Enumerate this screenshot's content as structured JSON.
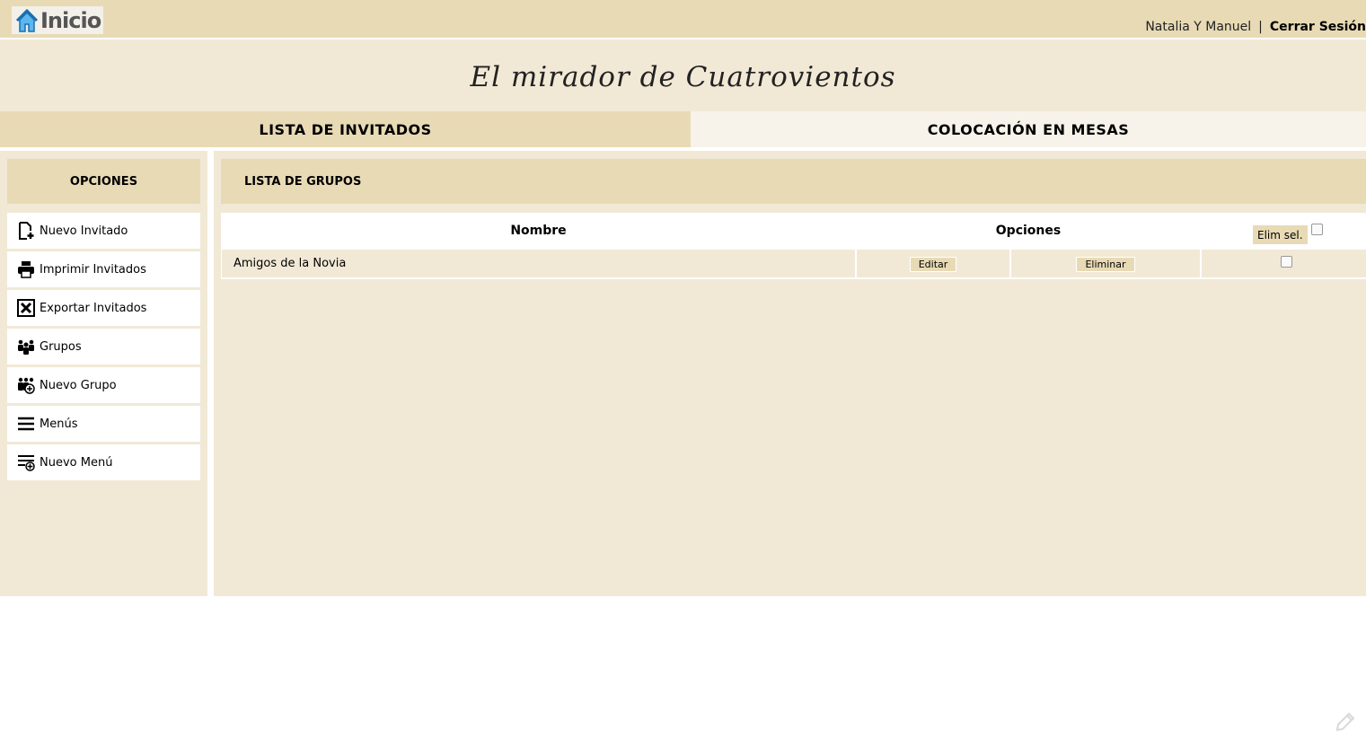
{
  "header": {
    "home_label": "Inicio",
    "user_name": "Natalia Y Manuel",
    "separator": "|",
    "logout_label": "Cerrar Sesión"
  },
  "banner": {
    "title": "El mirador de Cuatrovientos"
  },
  "tabs": [
    {
      "label": "LISTA DE INVITADOS",
      "active": true
    },
    {
      "label": "COLOCACIÓN EN MESAS",
      "active": false
    }
  ],
  "sidebar": {
    "title": "OPCIONES",
    "items": [
      {
        "label": "Nuevo Invitado",
        "icon": "new-file-icon"
      },
      {
        "label": "Imprimir Invitados",
        "icon": "printer-icon"
      },
      {
        "label": "Exportar Invitados",
        "icon": "excel-export-icon"
      },
      {
        "label": "Grupos",
        "icon": "group-icon"
      },
      {
        "label": "Nuevo Grupo",
        "icon": "add-group-icon"
      },
      {
        "label": "Menús",
        "icon": "menu-lines-icon"
      },
      {
        "label": "Nuevo Menú",
        "icon": "add-menu-icon"
      }
    ]
  },
  "main": {
    "title": "LISTA DE GRUPOS",
    "columns": {
      "name": "Nombre",
      "options": "Opciones",
      "delete_selected": "Elim sel."
    },
    "rows": [
      {
        "name": "Amigos de la Novia",
        "edit_label": "Editar",
        "delete_label": "Eliminar",
        "checked": false
      }
    ]
  },
  "colors": {
    "header_bg": "#e8dab5",
    "panel_bg": "#f1e9d6",
    "inactive_tab_bg": "#f7f3ea",
    "home_icon": "#3ba0e0"
  }
}
